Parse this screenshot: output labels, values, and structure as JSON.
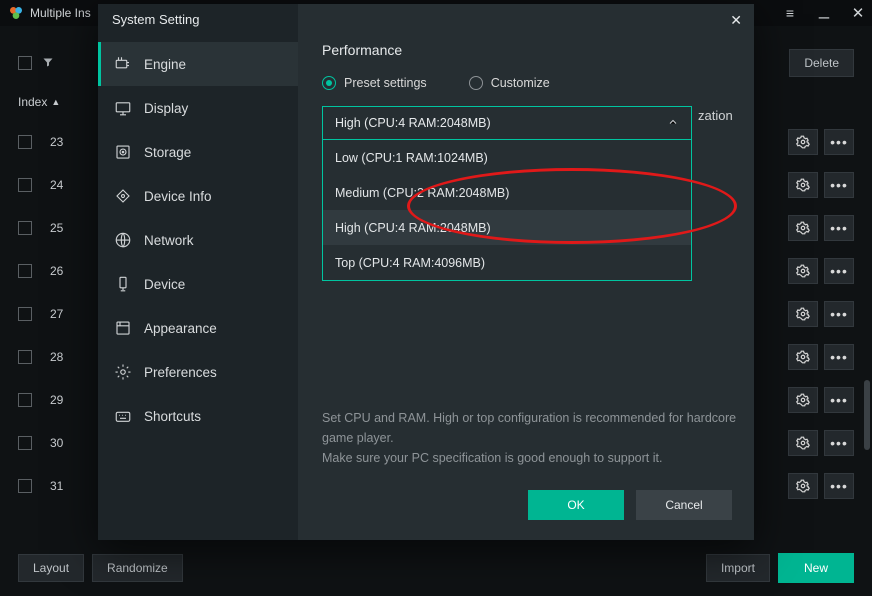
{
  "window": {
    "title": "Multiple Ins"
  },
  "under": {
    "delete_label": "Delete",
    "index_label": "Index",
    "rows": [
      "23",
      "24",
      "25",
      "26",
      "27",
      "28",
      "29",
      "30",
      "31"
    ]
  },
  "bottom": {
    "layout": "Layout",
    "randomize": "Randomize",
    "import": "Import",
    "new": "New"
  },
  "modal": {
    "title": "System Setting",
    "sidebar": [
      {
        "key": "engine",
        "label": "Engine"
      },
      {
        "key": "display",
        "label": "Display"
      },
      {
        "key": "storage",
        "label": "Storage"
      },
      {
        "key": "deviceinfo",
        "label": "Device Info"
      },
      {
        "key": "network",
        "label": "Network"
      },
      {
        "key": "device",
        "label": "Device"
      },
      {
        "key": "appearance",
        "label": "Appearance"
      },
      {
        "key": "preferences",
        "label": "Preferences"
      },
      {
        "key": "shortcuts",
        "label": "Shortcuts"
      }
    ],
    "active_sidebar": "engine",
    "section_title": "Performance",
    "radio_preset": "Preset settings",
    "radio_custom": "Customize",
    "radio_selected": "preset",
    "dropdown_value": "High (CPU:4 RAM:2048MB)",
    "dropdown_options": [
      "Low (CPU:1 RAM:1024MB)",
      "Medium (CPU:2 RAM:2048MB)",
      "High (CPU:4 RAM:2048MB)",
      "Top (CPU:4 RAM:4096MB)"
    ],
    "dropdown_hovered_index": 2,
    "peek_text": "zation",
    "help_line1": "Set CPU and RAM. High or top configuration is recommended for hardcore game player.",
    "help_line2": "Make sure your PC specification is good enough to support it.",
    "ok": "OK",
    "cancel": "Cancel"
  }
}
